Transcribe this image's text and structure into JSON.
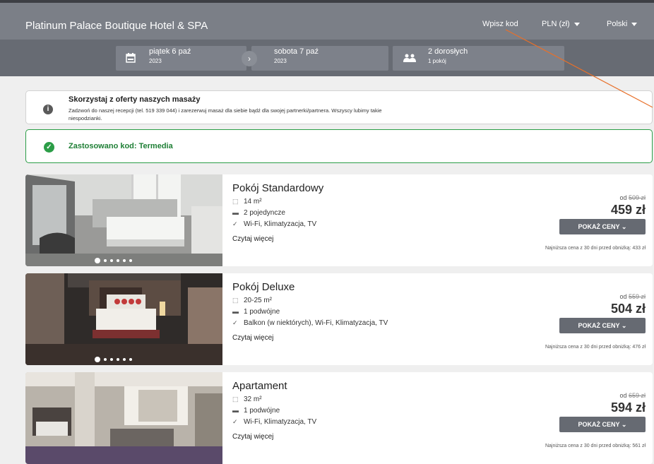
{
  "header": {
    "brand": "Platinum Palace Boutique Hotel & SPA",
    "code_link": "Wpisz kod",
    "currency": "PLN (zł)",
    "language": "Polski"
  },
  "search": {
    "checkin": {
      "day": "piątek 6 paź",
      "year": "2023"
    },
    "checkout": {
      "day": "sobota 7 paź",
      "year": "2023"
    },
    "guests": {
      "main": "2 dorosłych",
      "sub": "1 pokój"
    },
    "arrow": "›"
  },
  "info_banner": {
    "title": "Skorzystaj z oferty naszych masaży",
    "text": "Zadzwoń do naszej recepcji (tel. 519 339 044) i zarezerwuj masaż dla siebie bądź dla swojej partnerki/partnera. Wszyscy lubimy takie niespodzianki."
  },
  "code_banner": {
    "text": "Zastosowano kod: Termedia"
  },
  "rooms": [
    {
      "name": "Pokój Standardowy",
      "size": "14 m²",
      "beds": "2 pojedyncze",
      "amenities": "Wi-Fi, Klimatyzacja, TV",
      "read_more": "Czytaj więcej",
      "from_label": "od",
      "old_price": "509 zł",
      "price": "459 zł",
      "button": "POKAŻ CENY",
      "lowest": "Najniższa cena z 30 dni przed obniżką: 433 zł"
    },
    {
      "name": "Pokój Deluxe",
      "size": "20-25 m²",
      "beds": "1 podwójne",
      "amenities": "Balkon (w niektórych), Wi-Fi, Klimatyzacja, TV",
      "read_more": "Czytaj więcej",
      "from_label": "od",
      "old_price": "559 zł",
      "price": "504 zł",
      "button": "POKAŻ CENY",
      "lowest": "Najniższa cena z 30 dni przed obniżką: 476 zł"
    },
    {
      "name": "Apartament",
      "size": "32 m²",
      "beds": "1 podwójne",
      "amenities": "Wi-Fi, Klimatyzacja, TV",
      "read_more": "Czytaj więcej",
      "from_label": "od",
      "old_price": "659 zł",
      "price": "594 zł",
      "button": "POKAŻ CENY",
      "lowest": "Najniższa cena z 30 dni przed obniżką: 561 zł"
    }
  ],
  "icons": {
    "calendar": "calendar-icon",
    "guests": "people-icon",
    "info": "info-icon",
    "check": "check-circle-icon",
    "size": "area-icon",
    "bed": "bed-icon",
    "amenities": "check-icon",
    "dropdown": "chevron-down-icon"
  },
  "colors": {
    "header": "#7b7f87",
    "datebar": "#676b73",
    "success": "#2b9d47",
    "button": "#666a72",
    "annotation": "#e8702a"
  }
}
